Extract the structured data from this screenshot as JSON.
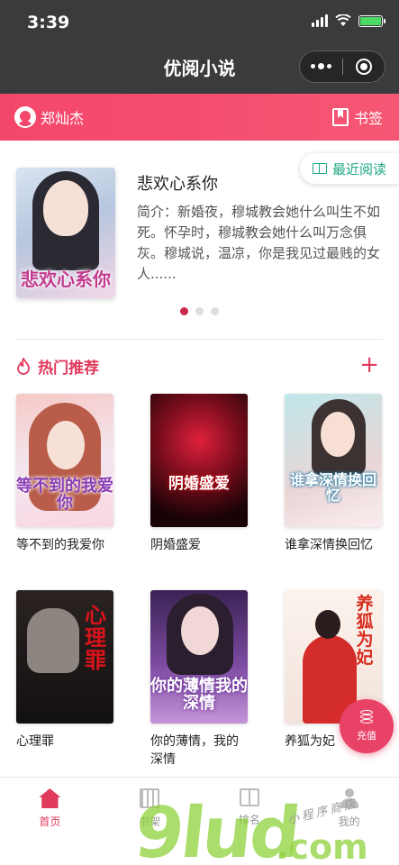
{
  "status": {
    "time": "3:39"
  },
  "nav": {
    "title": "优阅小说"
  },
  "userbar": {
    "username": "郑灿杰",
    "bookmark_label": "书签"
  },
  "featured": {
    "title": "悲欢心系你",
    "description": "简介：新婚夜，穆城教会她什么叫生不如死。怀孕时，穆城教会她什么叫万念俱灰。穆城说，温凉，你是我见过最贱的女人......",
    "cover_title": "悲欢心系你",
    "recent_label": "最近阅读",
    "pager_count": 3,
    "pager_active": 0
  },
  "hot": {
    "title": "热门推荐",
    "books": [
      {
        "name": "等不到的我爱你",
        "cover_title": "等不到的我爱你"
      },
      {
        "name": "阴婚盛爱",
        "cover_title": "阴婚盛爱"
      },
      {
        "name": "谁拿深情换回忆",
        "cover_title": "谁拿深情换回忆"
      },
      {
        "name": "心理罪",
        "cover_title": "心理罪"
      },
      {
        "name": "你的薄情，我的深情",
        "cover_title": "你的薄情我的深情"
      },
      {
        "name": "养狐为妃",
        "cover_title": "养狐为妃"
      }
    ]
  },
  "recharge": {
    "label": "充值"
  },
  "tabs": [
    {
      "label": "首页",
      "icon": "home-icon",
      "active": true
    },
    {
      "label": "书架",
      "icon": "shelf-icon",
      "active": false
    },
    {
      "label": "排名",
      "icon": "gift-icon",
      "active": false
    },
    {
      "label": "我的",
      "icon": "me-icon",
      "active": false
    }
  ],
  "watermark": {
    "main": "9lud",
    "suffix": ".com",
    "handwriting": "小程序商店"
  },
  "colors": {
    "accent": "#e03a5c",
    "nav_bg": "#3a3b3d",
    "recent_green": "#1ba784"
  }
}
